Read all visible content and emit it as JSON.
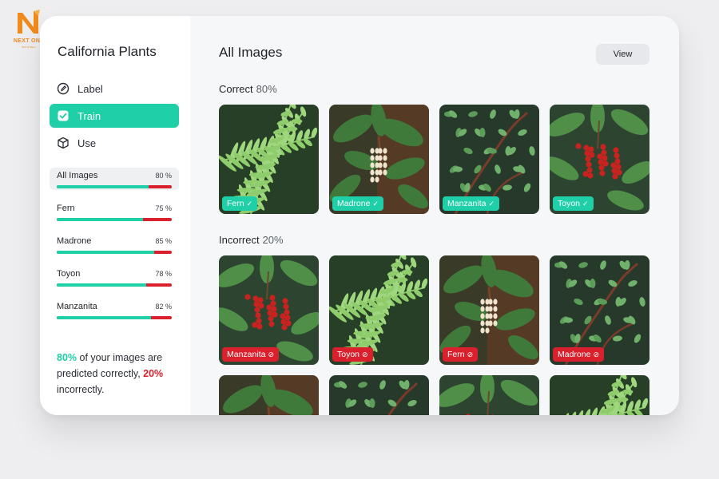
{
  "logo": {
    "name": "NEXT ONE",
    "tagline": "BUY & SELL"
  },
  "app": {
    "title": "California Plants"
  },
  "nav": [
    {
      "label": "Label",
      "icon": "edit-icon",
      "active": false
    },
    {
      "label": "Train",
      "icon": "checkbox-icon",
      "active": true
    },
    {
      "label": "Use",
      "icon": "cube-icon",
      "active": false
    }
  ],
  "metrics": [
    {
      "name": "All Images",
      "pct_label": "80 %",
      "pct": 80,
      "selected": true
    },
    {
      "name": "Fern",
      "pct_label": "75 %",
      "pct": 75,
      "selected": false
    },
    {
      "name": "Madrone",
      "pct_label": "85 %",
      "pct": 85,
      "selected": false
    },
    {
      "name": "Toyon",
      "pct_label": "78 %",
      "pct": 78,
      "selected": false
    },
    {
      "name": "Manzanita",
      "pct_label": "82 %",
      "pct": 82,
      "selected": false
    }
  ],
  "summary": {
    "correct_pct": "80%",
    "correct_text": " of your images are predicted correctly,",
    "incorrect_pct": "20%",
    "incorrect_text": " incorrectly."
  },
  "main": {
    "title": "All Images",
    "view_label": "View",
    "correct": {
      "heading": "Correct",
      "pct": "80%",
      "items": [
        {
          "label": "Fern",
          "plant": "fern",
          "mark": "✓"
        },
        {
          "label": "Madrone",
          "plant": "madrone",
          "mark": "✓"
        },
        {
          "label": "Manzanita",
          "plant": "manzanita",
          "mark": "✓"
        },
        {
          "label": "Toyon",
          "plant": "toyon",
          "mark": "✓"
        }
      ]
    },
    "incorrect": {
      "heading": "Incorrect",
      "pct": "20%",
      "items": [
        {
          "label": "Manzanita",
          "plant": "toyon",
          "mark": "⊘"
        },
        {
          "label": "Toyon",
          "plant": "fern",
          "mark": "⊘"
        },
        {
          "label": "Fern",
          "plant": "madrone",
          "mark": "⊘"
        },
        {
          "label": "Madrone",
          "plant": "manzanita",
          "mark": "⊘"
        }
      ]
    },
    "more": [
      {
        "plant": "madrone"
      },
      {
        "plant": "manzanita"
      },
      {
        "plant": "toyon"
      },
      {
        "plant": "fern"
      }
    ]
  },
  "colors": {
    "accent": "#1fcfa8",
    "error": "#d9202c",
    "logo": "#f08a1c"
  }
}
